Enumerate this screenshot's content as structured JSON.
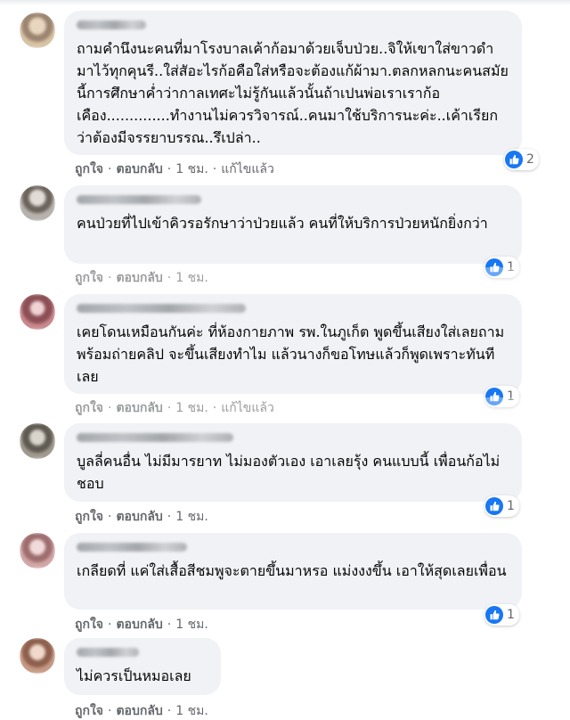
{
  "colors": {
    "bubble": "#f0f2f5",
    "like": "#1877f2",
    "meta": "#65676b"
  },
  "comments": [
    {
      "avatar_color": "#d8c3a5",
      "text": "ถามคำนึงนะคนที่มาโรงบาลเค้าก้อมาด้วยเจ็บป่วย..จิให้เขาใส่ขาวดำมาไว้ทุกคุนรี..ใส่สัอะไรก้อคือใส่หรือจะต้องแก้ผ้ามา.ตลกหลกนะคนสมัยนี้การศึกษาค่ำว่ากาลเทศะไม่รู้กันแล้วนั้นถ้าเปนพ่อเราเราก้อเคือง..............ทำงานไม่ควรวิจารณ์..คนมาใช้บริการนะค่ะ..เค้าเรียกว่าต้องมีจรรยาบรรณ..รึเปล่า..",
      "like": "ถูกใจ",
      "reply": "ตอบกลับ",
      "time": "1 ชม.",
      "edited": "แก้ไขแล้ว",
      "react_count": "2"
    },
    {
      "avatar_color": "#b7b2ad",
      "text": "คนป่วยที่ไปเข้าคิวรอรักษาว่าป่วยแล้ว คนที่ให้บริการป่วยหนักยิ่งกว่า",
      "like": "ถูกใจ",
      "reply": "ตอบกลับ",
      "time": "1 ชม.",
      "edited": "",
      "react_count": "1"
    },
    {
      "avatar_color": "#c9898e",
      "text": "เคยโดนเหมือนกันค่ะ ที่ห้องกายภาพ รพ.ในภูเก็ต พูดขึ้นเสียงใส่เลยถามพร้อมถ่ายคลิป จะขึ้นเสียงทำไม แล้วนางก็ขอโทษแล้วก็พูดเพราะทันทีเลย",
      "like": "ถูกใจ",
      "reply": "ตอบกลับ",
      "time": "1 ชม.",
      "edited": "แก้ไขแล้ว",
      "react_count": "1"
    },
    {
      "avatar_color": "#a09a8e",
      "text": "บูลลี่คนอื่น ไม่มีมารยาท ไม่มองตัวเอง เอาเลยรุ้ง คนแบบนี้ เพื่อนก้อไม่ชอบ",
      "like": "ถูกใจ",
      "reply": "ตอบกลับ",
      "time": "1 ชม.",
      "edited": "",
      "react_count": "1"
    },
    {
      "avatar_color": "#d3a7a7",
      "text": "เกลียดที่ แค่ใส่เสื้อสีชมพูจะตายขึ้นมาหรอ แม่งงงขึ้น เอาให้สุดเลยเพื่อน",
      "like": "ถูกใจ",
      "reply": "ตอบกลับ",
      "time": "1 ชม.",
      "edited": "",
      "react_count": "1"
    },
    {
      "avatar_color": "#c79a86",
      "text": "ไม่ควรเป็นหมอเลย",
      "like": "ถูกใจ",
      "reply": "ตอบกลับ",
      "time": "1 ชม.",
      "edited": "",
      "react_count": ""
    }
  ]
}
